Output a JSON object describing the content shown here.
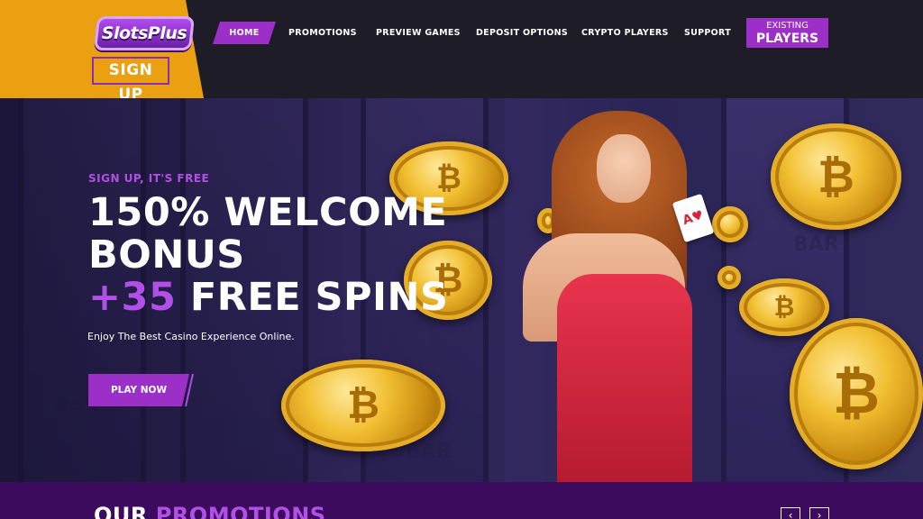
{
  "header": {
    "logo_text": "SlotsPlus",
    "signup_label": "SIGN UP",
    "nav": [
      {
        "label": "HOME"
      },
      {
        "label": "PROMOTIONS"
      },
      {
        "label": "PREVIEW GAMES"
      },
      {
        "label": "DEPOSIT OPTIONS"
      },
      {
        "label": "CRYPTO PLAYERS"
      },
      {
        "label": "SUPPORT"
      }
    ],
    "existing_line1": "EXISTING",
    "existing_line2": "PLAYERS"
  },
  "hero": {
    "kicker": "SIGN UP, IT'S FREE",
    "line1": "150% WELCOME",
    "line2": "BONUS",
    "line3_accent": "+35",
    "line3_rest": " FREE SPINS",
    "subtext": "Enjoy The Best Casino Experience Online.",
    "cta_label": "PLAY NOW",
    "coin_symbol": "₿",
    "reel_text": "BAR"
  },
  "promotions": {
    "title_white": "OUR ",
    "title_accent": "PROMOTIONS",
    "prev_icon": "‹",
    "next_icon": "›"
  },
  "colors": {
    "accent_purple": "#9b2fc7",
    "logo_orange": "#eba012",
    "header_bg": "#1e1d27"
  }
}
